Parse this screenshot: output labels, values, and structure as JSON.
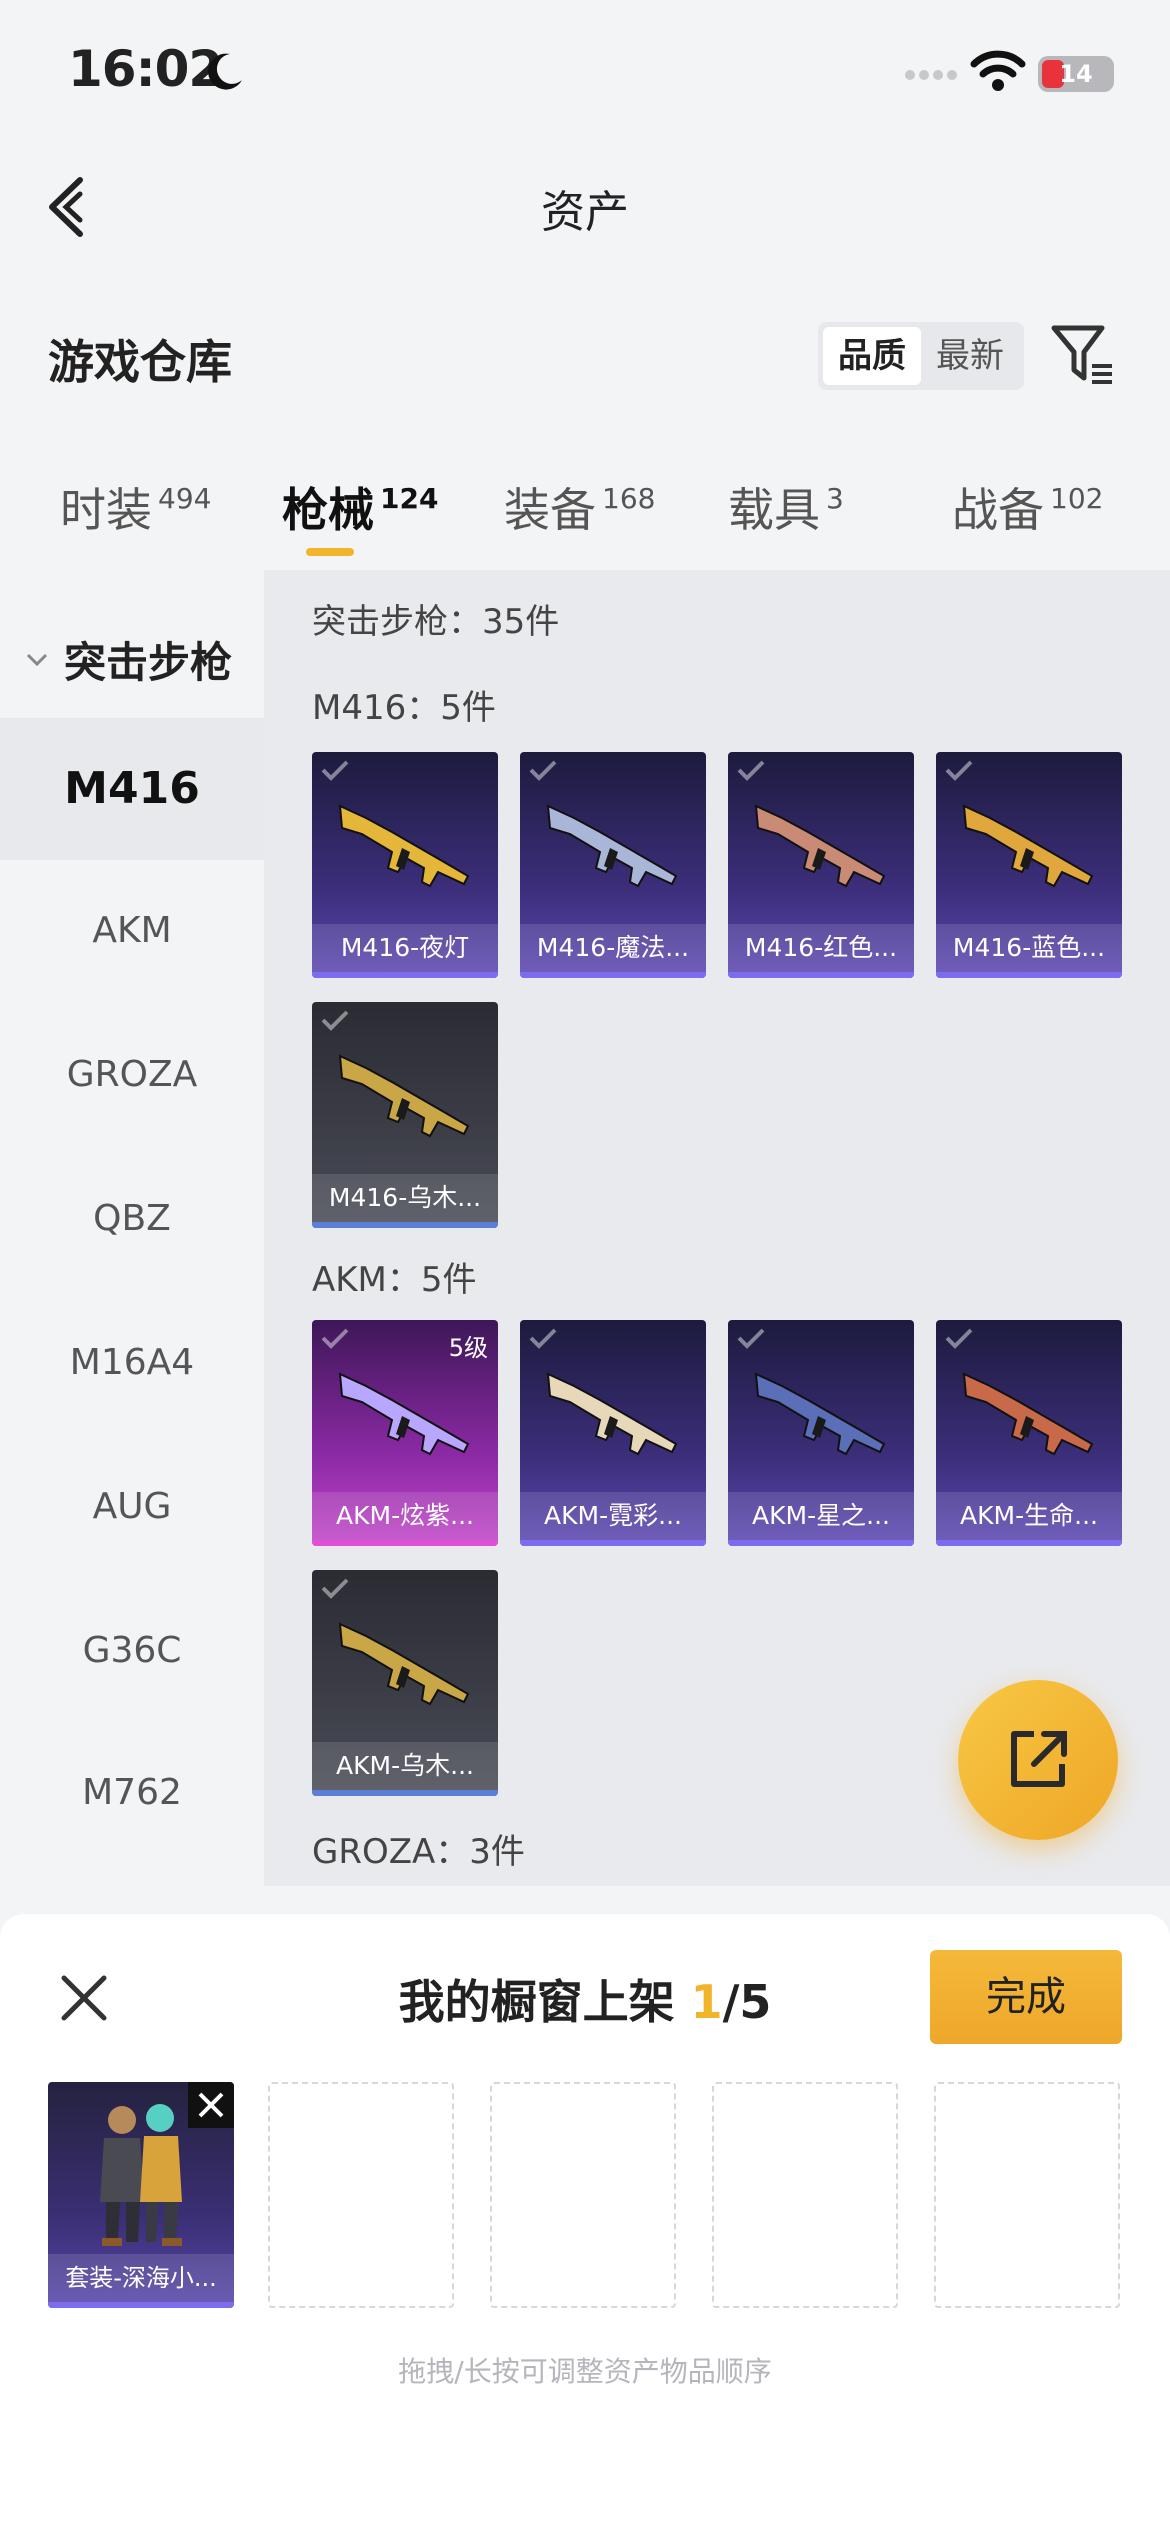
{
  "status": {
    "time": "16:02",
    "battery": "14"
  },
  "nav": {
    "title": "资产"
  },
  "warehouse": {
    "title": "游戏仓库",
    "sort_options": [
      "品质",
      "最新"
    ]
  },
  "tabs": [
    {
      "label": "时装",
      "count": "494"
    },
    {
      "label": "枪械",
      "count": "124"
    },
    {
      "label": "装备",
      "count": "168"
    },
    {
      "label": "载具",
      "count": "3"
    },
    {
      "label": "战备",
      "count": "102"
    }
  ],
  "sidebar": {
    "category": "突击步枪",
    "items": [
      "M416",
      "AKM",
      "GROZA",
      "QBZ",
      "M16A4",
      "AUG",
      "G36C",
      "M762"
    ]
  },
  "content": {
    "summary": "突击步枪：35件",
    "groups": [
      {
        "label": "M416：5件",
        "items": [
          {
            "name": "M416-夜灯",
            "style": "purple",
            "gun_color": "#e4b73a"
          },
          {
            "name": "M416-魔法...",
            "style": "purple",
            "gun_color": "#aab6d8"
          },
          {
            "name": "M416-红色...",
            "style": "purple",
            "gun_color": "#c98a76"
          },
          {
            "name": "M416-蓝色...",
            "style": "purple",
            "gun_color": "#e0a73c"
          },
          {
            "name": "M416-乌木...",
            "style": "grey",
            "gun_color": "#c9a646"
          }
        ]
      },
      {
        "label": "AKM：5件",
        "items": [
          {
            "name": "AKM-炫紫...",
            "style": "pink",
            "level": "5级",
            "gun_color": "#b9a7ff"
          },
          {
            "name": "AKM-霓彩...",
            "style": "purple",
            "gun_color": "#e6d8b8"
          },
          {
            "name": "AKM-星之...",
            "style": "purple",
            "gun_color": "#5a6fb8"
          },
          {
            "name": "AKM-生命...",
            "style": "purple",
            "gun_color": "#c86a4a"
          },
          {
            "name": "AKM-乌木...",
            "style": "grey",
            "gun_color": "#c9a646"
          }
        ]
      },
      {
        "label": "GROZA：3件"
      }
    ]
  },
  "sheet": {
    "title": "我的橱窗上架",
    "count_current": "1",
    "count_total": "/5",
    "done_label": "完成",
    "slot_item": "套装-深海小...",
    "hint": "拖拽/长按可调整资产物品顺序"
  },
  "colors": {
    "accent": "#f1b42b",
    "purple_card": "#3c2e7a",
    "grey_card": "#4a4c57",
    "pink_card": "#8c2aa6"
  }
}
